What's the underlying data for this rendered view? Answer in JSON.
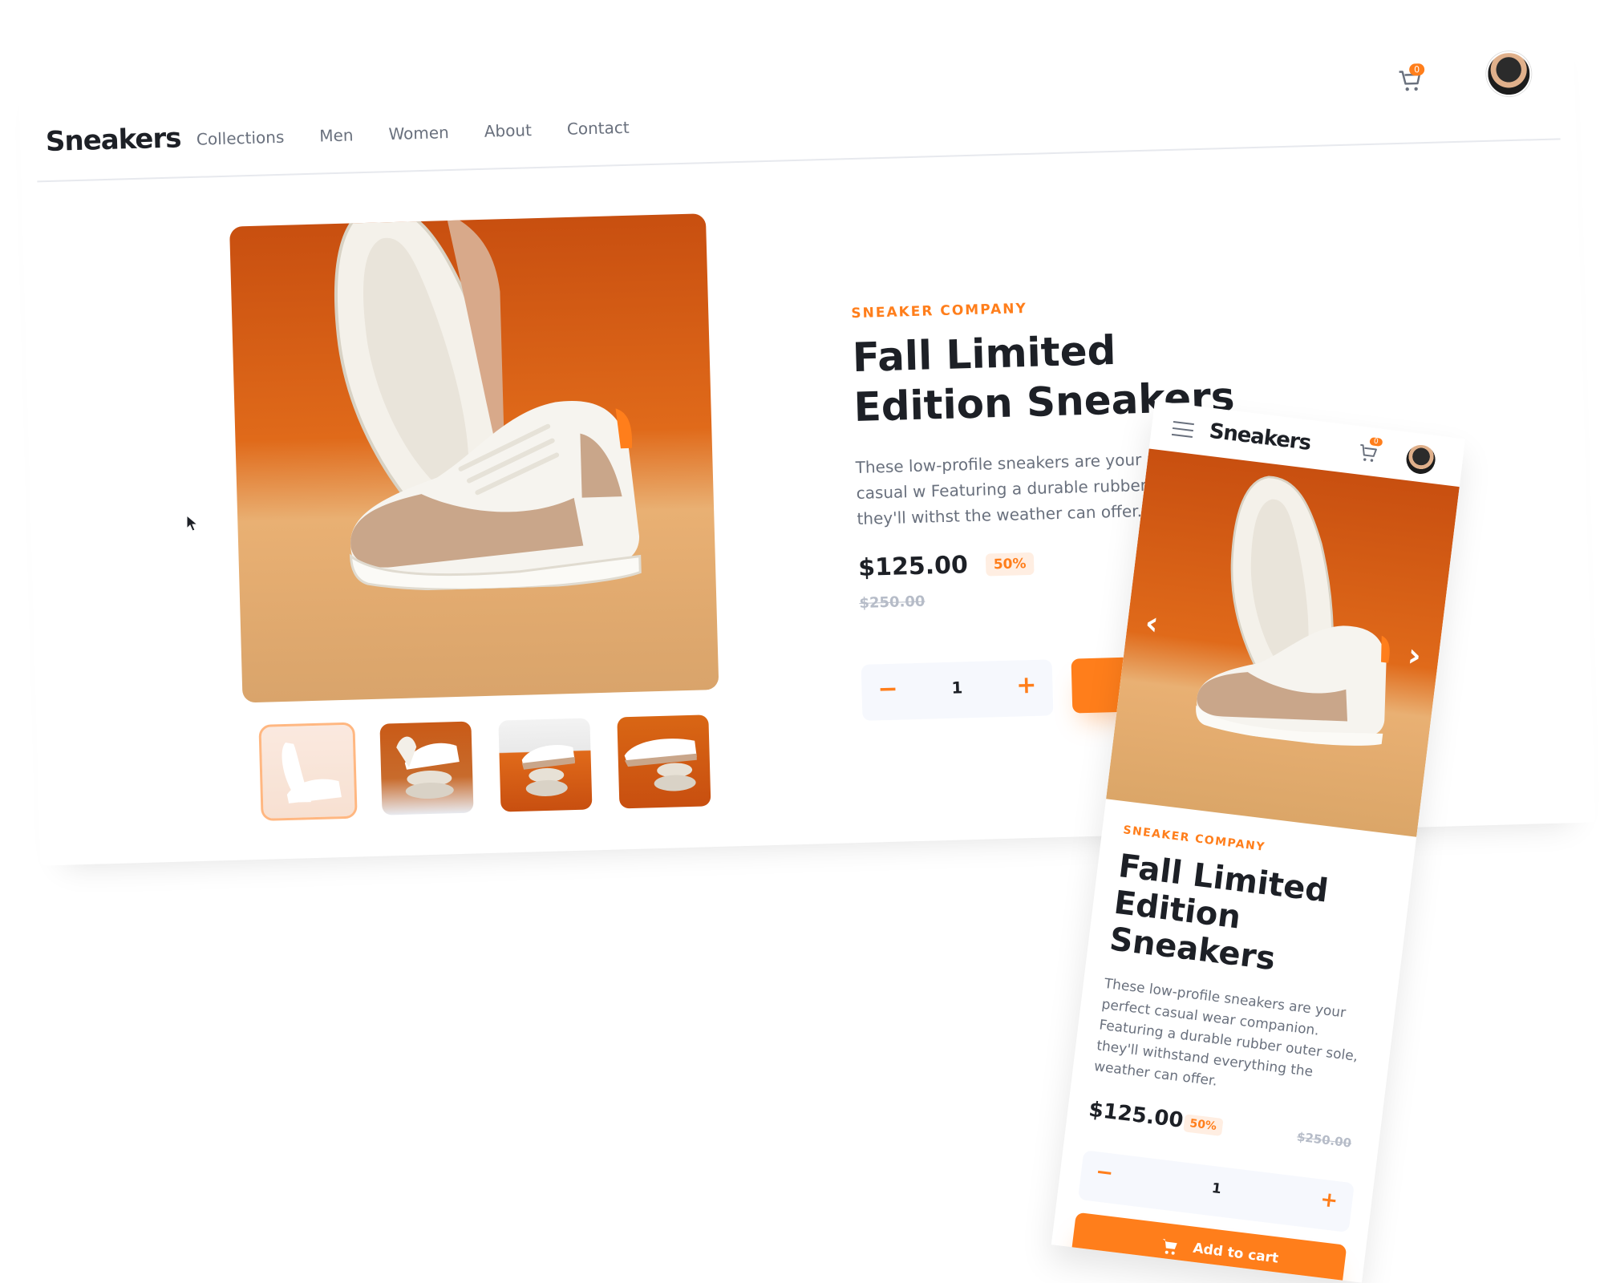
{
  "brand": {
    "logo": "Sneakers",
    "accent": "#ff7e1b",
    "dark": "#1d2026",
    "muted": "#69707d"
  },
  "nav": {
    "links": [
      "Collections",
      "Men",
      "Women",
      "About",
      "Contact"
    ],
    "cart_count": "0",
    "icons": {
      "cart": "cart-icon",
      "avatar": "avatar",
      "menu": "menu-icon"
    }
  },
  "product": {
    "company": "SNEAKER COMPANY",
    "title": "Fall Limited Edition Sneakers",
    "desktop_description": "These low-profile sneakers are your perfect casual w Featuring a durable rubber outer sole, they'll withst the weather can offer.",
    "mobile_description": "These low-profile sneakers are your perfect casual wear companion. Featuring a durable rubber outer sole, they'll withstand everything the weather can offer.",
    "price": "$125.00",
    "discount": "50%",
    "original_price": "$250.00",
    "quantity": "1",
    "minus": "−",
    "plus": "+",
    "desktop_add_label": "A",
    "add_to_cart": "Add to cart",
    "thumbnails": [
      "thumbnail-1",
      "thumbnail-2",
      "thumbnail-3",
      "thumbnail-4"
    ],
    "active_thumbnail": 1
  },
  "mobile": {
    "logo": "Sneakers",
    "title_lines": [
      "Fall Limited",
      "Edition Sneakers"
    ],
    "cart_count": "0",
    "prev_arrow": "‹",
    "next_arrow": "›"
  }
}
